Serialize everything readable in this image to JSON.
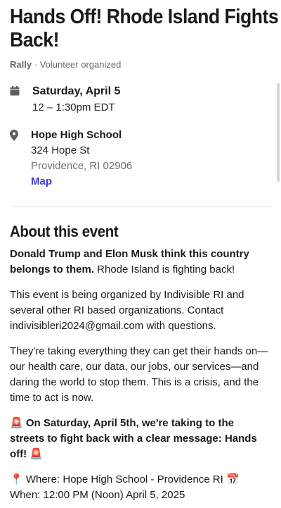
{
  "event": {
    "title": "Hands Off! Rhode Island Fights Back!",
    "type": "Rally",
    "separator": "·",
    "organizer": "Volunteer organized",
    "date_title": "Saturday, April 5",
    "time": "12 – 1:30pm EDT",
    "location_name": "Hope High School",
    "address_line1": "324 Hope St",
    "address_line2": "Providence, RI 02906",
    "map_label": "Map"
  },
  "icons": {
    "calendar": "calendar-icon",
    "location": "location-pin-icon"
  },
  "about": {
    "heading": "About this event",
    "p1_bold": "Donald Trump and Elon Musk think this country belongs to them.",
    "p1_rest": " Rhode Island is fighting back!",
    "p2": "This event is being organized by Indivisible RI and several other RI based organizations. Contact indivisibleri2024@gmail.com with questions.",
    "p3": "They're taking everything they can get their hands on—our health care, our data, our jobs, our services—and daring the world to stop them. This is a crisis, and the time to act is now.",
    "p4_emoji_start": "🚨",
    "p4_bold": " On Saturday, April 5th, we're taking to the streets to fight back with a clear message: Hands off! ",
    "p4_emoji_end": "🚨",
    "p5": "📍 Where: Hope High School - Providence RI 📅 When: 12:00 PM (Noon) April 5, 2025"
  },
  "colors": {
    "link": "#3b3bd6",
    "muted": "#6b6b6b"
  }
}
